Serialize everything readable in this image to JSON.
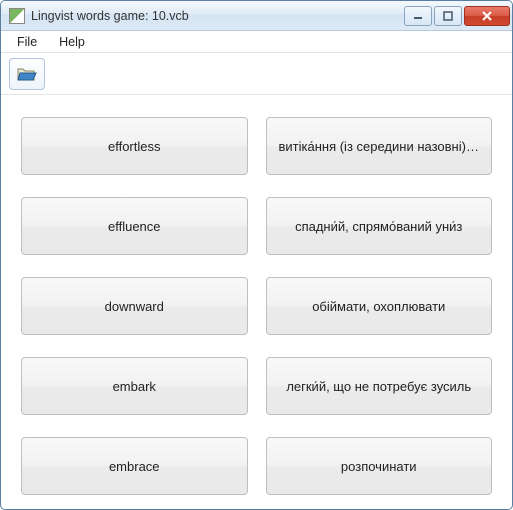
{
  "window": {
    "title": "Lingvist words game: 10.vcb"
  },
  "menu": {
    "file": "File",
    "help": "Help"
  },
  "words": {
    "left": [
      "effortless",
      "effluence",
      "downward",
      "embark",
      "embrace"
    ],
    "right": [
      "витіка́ння (із середини назовні), випромінювання",
      "спадни́й, спрямо́ваний уни́з",
      "обіймати, охоплювати",
      "легки́й, що не потребує зусиль",
      "розпочинати"
    ]
  }
}
